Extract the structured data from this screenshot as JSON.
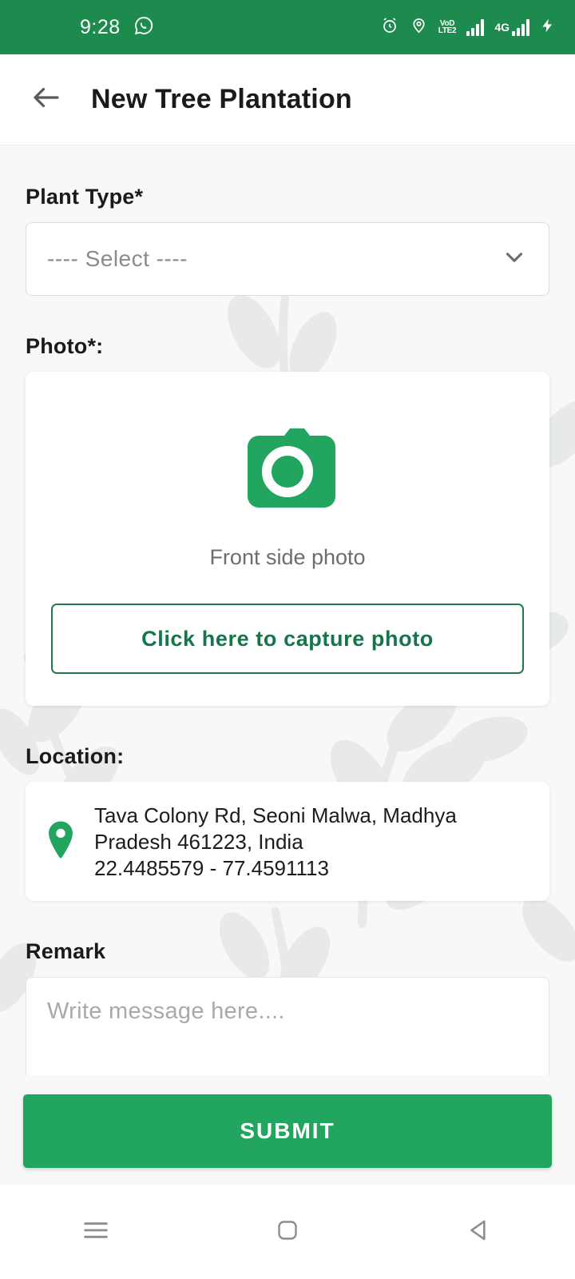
{
  "status_bar": {
    "time": "9:28",
    "background_color": "#1e8b4e",
    "left_icons": [
      "whatsapp-icon"
    ],
    "right_icons": [
      "alarm-icon",
      "location-icon",
      "volte-icon",
      "signal-bars-icon",
      "4g-signal-icon",
      "charging-bolt-icon"
    ],
    "volte_line1": "VoD",
    "volte_line2": "LTE2",
    "network_label": "4G"
  },
  "app_bar": {
    "back_icon": "arrow-left-icon",
    "title": "New Tree Plantation"
  },
  "form": {
    "plant_type": {
      "label": "Plant Type*",
      "selected_value": "---- Select ----",
      "chevron_icon": "chevron-down-icon"
    },
    "photo": {
      "label": "Photo*:",
      "camera_icon": "camera-icon",
      "caption": "Front side photo",
      "capture_button_label": "Click here to capture photo"
    },
    "location": {
      "label": "Location:",
      "pin_icon": "map-pin-icon",
      "address_line1": "Tava Colony Rd, Seoni Malwa, Madhya",
      "address_line2": "Pradesh 461223, India",
      "coordinates": "22.4485579 - 77.4591113"
    },
    "remark": {
      "label": "Remark",
      "placeholder": "Write message here....",
      "value": ""
    }
  },
  "submit": {
    "label": "SUBMIT",
    "color": "#22a55e"
  },
  "nav_bar": {
    "recents_icon": "recents-menu-icon",
    "home_icon": "home-square-icon",
    "back_icon": "back-triangle-icon"
  },
  "theme": {
    "primary_green": "#22a55e",
    "status_green": "#1e8b4e",
    "outline_green": "#1e7a4a",
    "page_bg": "#f7f8f7"
  }
}
